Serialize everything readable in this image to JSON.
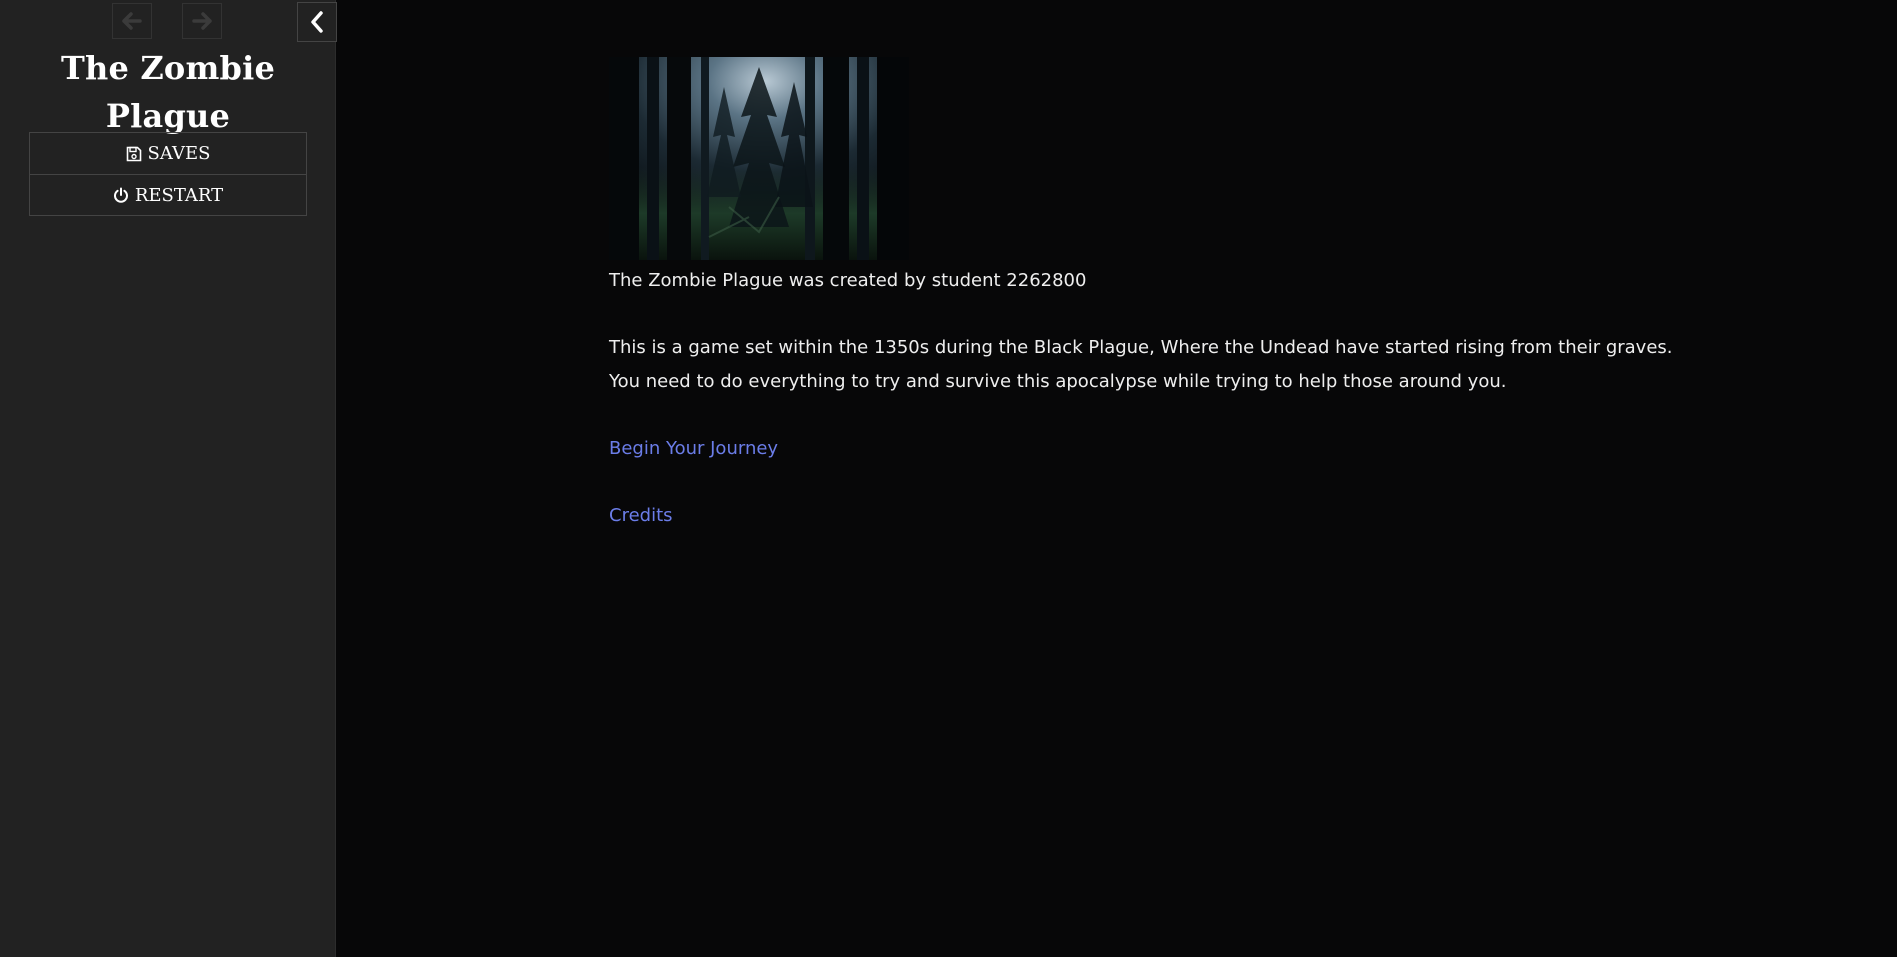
{
  "sidebar": {
    "story_title": "The Zombie Plague",
    "history": {
      "back_icon": "arrow-left-icon",
      "forward_icon": "arrow-right-icon"
    },
    "toggle_icon": "chevron-left-icon",
    "menu": [
      {
        "label": "SAVES",
        "icon": "floppy-disk-icon"
      },
      {
        "label": "RESTART",
        "icon": "power-icon"
      }
    ]
  },
  "passage": {
    "image_alt": "dark forest",
    "credit_line": "The Zombie Plague was created by student 2262800",
    "description_line1": "This is a game set within the 1350s during the Black Plague, Where the Undead have started rising from their graves.",
    "description_line2": "You need to do everything to try and survive this apocalypse while trying to help those around you.",
    "links": [
      {
        "label": "Begin Your Journey"
      },
      {
        "label": "Credits"
      }
    ]
  },
  "colors": {
    "background": "#070708",
    "sidebar": "#222222",
    "text": "#eeeeee",
    "link": "#6b7de8"
  }
}
